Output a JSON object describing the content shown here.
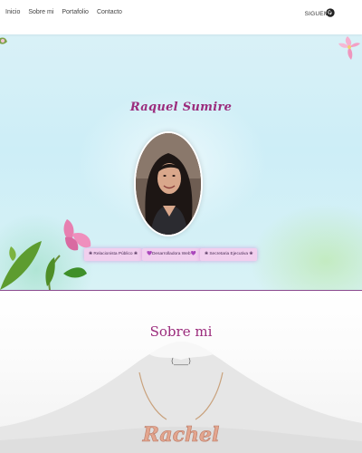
{
  "nav": {
    "links": [
      "Inicio",
      "Sobre mi",
      "Portafolio",
      "Contacto"
    ],
    "follow_label": "SIGUEME",
    "follow_icon": "github-icon"
  },
  "hero": {
    "name": "Raquel Sumire",
    "tags": [
      "❀ Relacionista Público ❀",
      "💜Desarrolladora Web💜",
      "❀ Secretaria Ejecutiva ❀"
    ],
    "accent": "#9b2b7c",
    "tag_bg": "#f1cfee"
  },
  "about": {
    "title": "Sobre mi",
    "ornament": "⟨____⟩",
    "necklace_text": "Rachel"
  }
}
